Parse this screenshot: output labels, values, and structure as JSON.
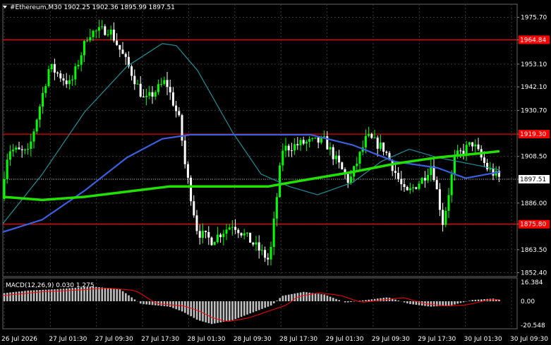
{
  "header": {
    "symbol_text": "#Ethereum,M30  1902.25 1902.36 1895.99 1897.51"
  },
  "colors": {
    "background": "#000000",
    "bull_candle": "#00ff00",
    "bear_candle": "#ffffff",
    "grid": "#3a3a3a",
    "resistance": "#ff0000",
    "ma_fast": "#1f8f9a",
    "ma_mid": "#3a5fe0",
    "ma_slow": "#22e000",
    "macd_hist": "#c0c0c0",
    "macd_signal": "#ff0000",
    "current_price_bg": "#ffffff"
  },
  "price_axis": {
    "ticks": [
      "1975.70",
      "1964.84",
      "1953.10",
      "1942.10",
      "1930.70",
      "1919.30",
      "1908.50",
      "1897.51",
      "1886.00",
      "1875.80",
      "1863.50",
      "1852.40"
    ],
    "current_price": "1897.51",
    "levels": [
      "1964.84",
      "1919.30",
      "1875.80"
    ]
  },
  "time_axis": {
    "labels": [
      "26 Jul 2026",
      "27 Jul 01:30",
      "27 Jul 09:30",
      "27 Jul 17:30",
      "28 Jul 01:30",
      "28 Jul 09:30",
      "28 Jul 17:30",
      "29 Jul 01:30",
      "29 Jul 09:30",
      "29 Jul 17:30",
      "30 Jul 01:30",
      "30 Jul 09:30"
    ]
  },
  "macd": {
    "title": "MACD(12,26,9) 0.030 1.275",
    "ticks": [
      "16.384",
      "0.00",
      "-20.548"
    ]
  }
}
